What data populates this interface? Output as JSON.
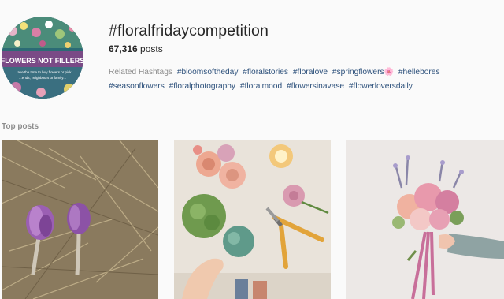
{
  "hashtag": {
    "title": "#floralfridaycompetition",
    "post_count": "67,316",
    "posts_label": "posts",
    "avatar_banner": "FLOWERS NOT FILLERS",
    "avatar_caption_1": "...take the time to buy flowers or pick",
    "avatar_caption_2": "...ends, neighbours or family..."
  },
  "related": {
    "label": "Related Hashtags",
    "tags": [
      "#bloomsoftheday",
      "#floralstories",
      "#floralove",
      "#springflowers",
      "#hellebores",
      "#seasonflowers",
      "#floralphotography",
      "#floralmood",
      "#flowersinavase",
      "#flowerloversdaily"
    ],
    "emoji": "🌸"
  },
  "top_posts": {
    "label": "Top posts",
    "items": [
      {
        "subject": "pasque-flowers-in-dry-grass"
      },
      {
        "subject": "flowers-and-pruning-shears-on-table"
      },
      {
        "subject": "hand-holding-pink-bouquet"
      }
    ]
  },
  "colors": {
    "link": "#2b4f7a",
    "muted": "#8e8e8e",
    "text": "#262626",
    "background": "#fafafa"
  }
}
